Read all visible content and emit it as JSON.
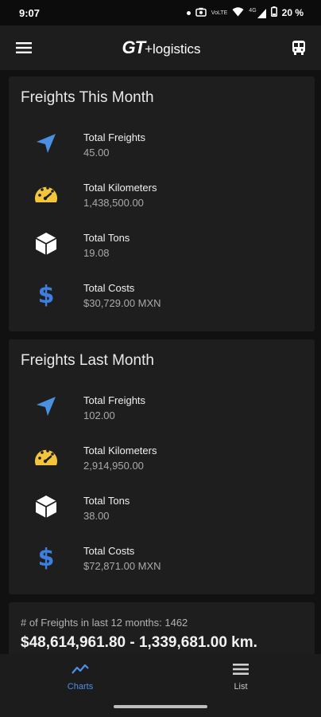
{
  "status_bar": {
    "time": "9:07",
    "volte": "VoLTE",
    "network": "4G",
    "battery": "20 %"
  },
  "app_bar": {
    "logo_bold": "GT",
    "logo_rest": "+logistics"
  },
  "this_month": {
    "title": "Freights This Month",
    "stats": [
      {
        "icon": "navigation-arrow-icon",
        "label": "Total Freights",
        "value": "45.00"
      },
      {
        "icon": "speedometer-icon",
        "label": "Total Kilometers",
        "value": "1,438,500.00"
      },
      {
        "icon": "cube-icon",
        "label": "Total Tons",
        "value": "19.08"
      },
      {
        "icon": "dollar-icon",
        "label": "Total Costs",
        "value": "$30,729.00 MXN"
      }
    ]
  },
  "last_month": {
    "title": "Freights Last Month",
    "stats": [
      {
        "icon": "navigation-arrow-icon",
        "label": "Total Freights",
        "value": "102.00"
      },
      {
        "icon": "speedometer-icon",
        "label": "Total Kilometers",
        "value": "2,914,950.00"
      },
      {
        "icon": "cube-icon",
        "label": "Total Tons",
        "value": "38.00"
      },
      {
        "icon": "dollar-icon",
        "label": "Total Costs",
        "value": "$72,871.00 MXN"
      }
    ]
  },
  "summary": {
    "count_text": "# of Freights in last 12 months: 1462",
    "total_text": "$48,614,961.80 - 1,339,681.00 km."
  },
  "bottom_nav": {
    "items": [
      {
        "icon": "chart-line-icon",
        "label": "Charts",
        "active": true
      },
      {
        "icon": "list-icon",
        "label": "List",
        "active": false
      }
    ]
  },
  "colors": {
    "nav_blue": "#4f8fe8",
    "speedometer_yellow": "#f2c53d",
    "arrow_blue": "#4a90e2",
    "dollar_blue": "#3d7fe0"
  }
}
